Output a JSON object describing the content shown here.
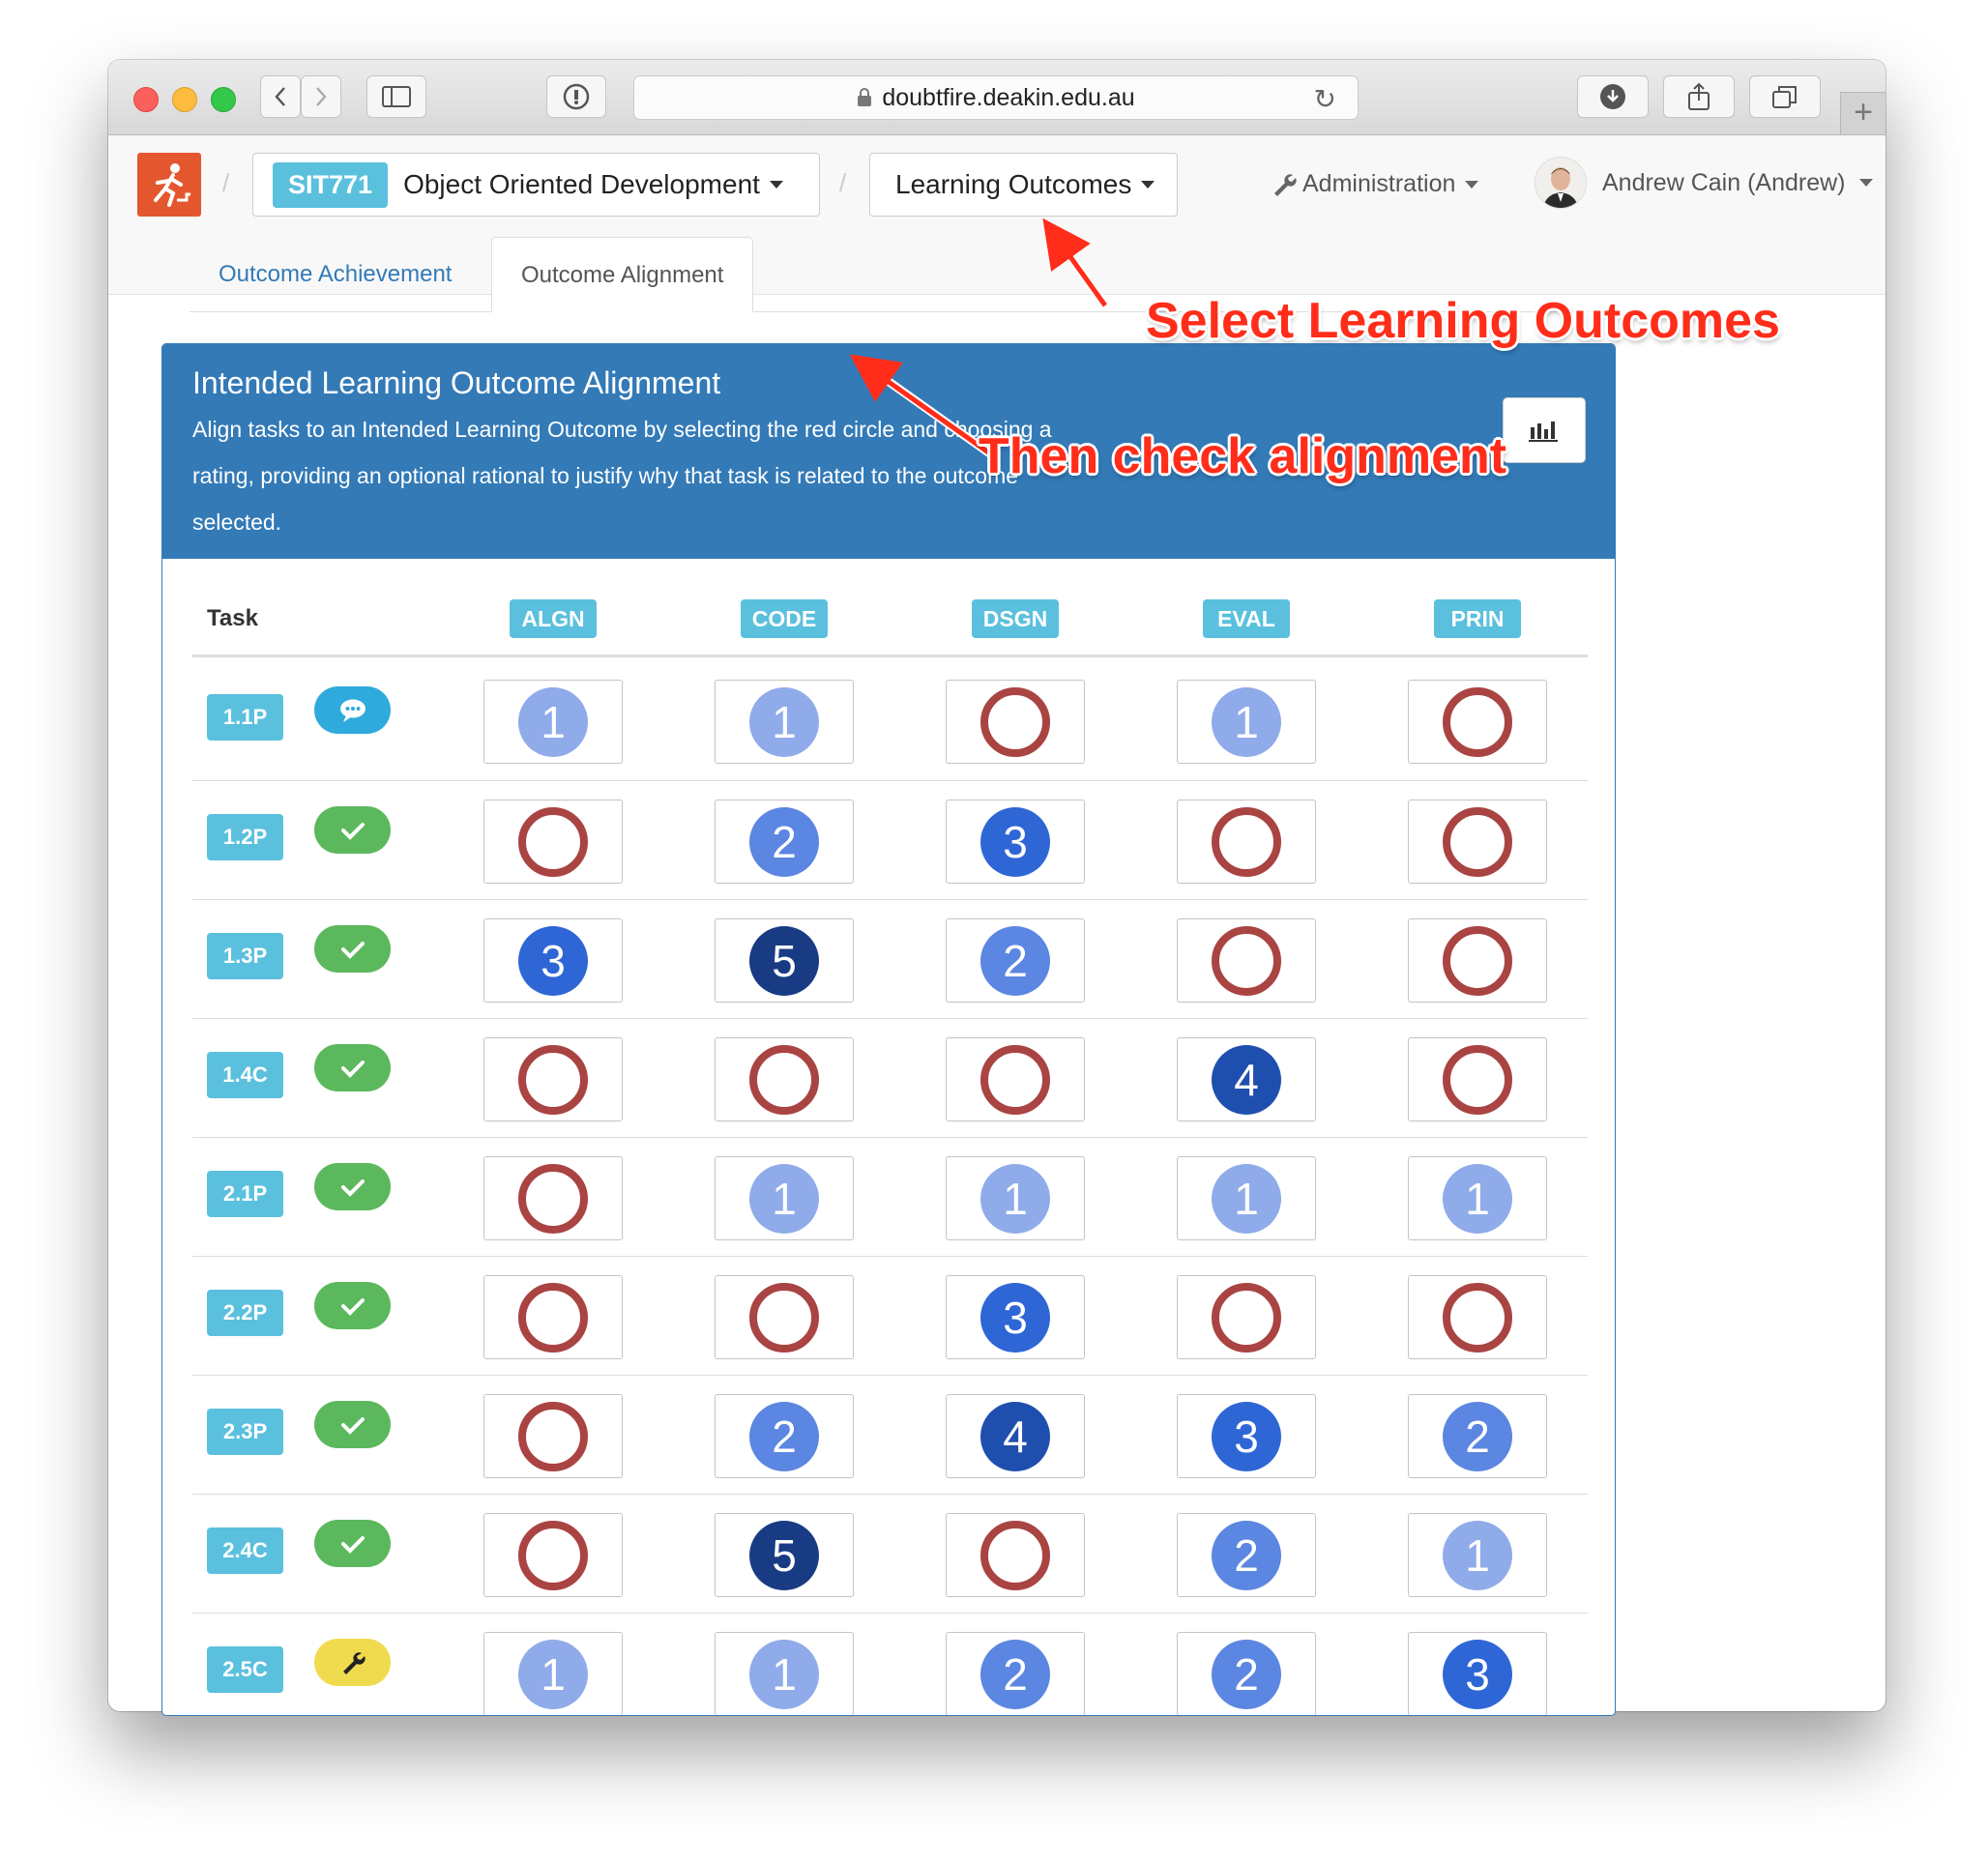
{
  "browser": {
    "url": "doubtfire.deakin.edu.au"
  },
  "navbar": {
    "unit_code": "SIT771",
    "unit_name": "Object Oriented Development",
    "page_menu": "Learning Outcomes",
    "admin_menu": "Administration",
    "user_name": "Andrew Cain (Andrew)"
  },
  "tabs": [
    {
      "label": "Outcome Achievement",
      "active": false
    },
    {
      "label": "Outcome Alignment",
      "active": true
    }
  ],
  "panel": {
    "title": "Intended Learning Outcome Alignment",
    "description": "Align tasks to an Intended Learning Outcome by selecting the red circle and choosing a rating, providing an optional rational to justify why that task is related to the outcome selected."
  },
  "grid": {
    "task_header": "Task",
    "outcomes": [
      "ALGN",
      "CODE",
      "DSGN",
      "EVAL",
      "PRIN"
    ],
    "rows": [
      {
        "task": "1.1P",
        "status": "discuss",
        "ratings": [
          1,
          1,
          0,
          1,
          0
        ]
      },
      {
        "task": "1.2P",
        "status": "complete",
        "ratings": [
          0,
          2,
          3,
          0,
          0
        ]
      },
      {
        "task": "1.3P",
        "status": "complete",
        "ratings": [
          3,
          5,
          2,
          0,
          0
        ]
      },
      {
        "task": "1.4C",
        "status": "complete",
        "ratings": [
          0,
          0,
          0,
          4,
          0
        ]
      },
      {
        "task": "2.1P",
        "status": "complete",
        "ratings": [
          0,
          1,
          1,
          1,
          1
        ]
      },
      {
        "task": "2.2P",
        "status": "complete",
        "ratings": [
          0,
          0,
          3,
          0,
          0
        ]
      },
      {
        "task": "2.3P",
        "status": "complete",
        "ratings": [
          0,
          2,
          4,
          3,
          2
        ]
      },
      {
        "task": "2.4C",
        "status": "complete",
        "ratings": [
          0,
          5,
          0,
          2,
          1
        ]
      },
      {
        "task": "2.5C",
        "status": "fix",
        "ratings": [
          1,
          1,
          2,
          2,
          3
        ]
      }
    ]
  },
  "annotations": {
    "select": "Select Learning Outcomes",
    "check": "Then check alignment"
  },
  "colors": {
    "primary": "#337ab7",
    "info": "#5bc0de",
    "success": "#5cb85c",
    "empty_circle": "#a94442",
    "annotation": "#ff2d1a"
  }
}
